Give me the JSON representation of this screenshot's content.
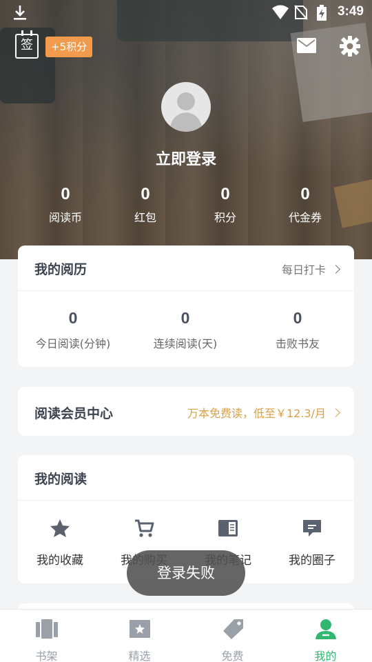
{
  "status_bar": {
    "time": "3:49"
  },
  "header": {
    "sign_icon_char": "签",
    "points_badge": "+5积分",
    "login_text": "立即登录",
    "stats": [
      {
        "value": "0",
        "label": "阅读币"
      },
      {
        "value": "0",
        "label": "红包"
      },
      {
        "value": "0",
        "label": "积分"
      },
      {
        "value": "0",
        "label": "代金券"
      }
    ]
  },
  "history": {
    "title": "我的阅历",
    "link": "每日打卡",
    "items": [
      {
        "value": "0",
        "label": "今日阅读(分钟)"
      },
      {
        "value": "0",
        "label": "连续阅读(天)"
      },
      {
        "value": "0",
        "label": "击败书友"
      }
    ]
  },
  "vip": {
    "title": "阅读会员中心",
    "promo": "万本免费读，低至￥12.3/月"
  },
  "my_reading": {
    "title": "我的阅读",
    "items": [
      {
        "label": "我的收藏",
        "icon": "star-icon"
      },
      {
        "label": "我的购买",
        "icon": "cart-icon"
      },
      {
        "label": "我的笔记",
        "icon": "notebook-icon"
      },
      {
        "label": "我的圈子",
        "icon": "chat-bubble-icon"
      }
    ]
  },
  "toast": {
    "text": "登录失败"
  },
  "bottom_nav": {
    "items": [
      {
        "label": "书架",
        "icon": "bookshelf-icon",
        "active": false
      },
      {
        "label": "精选",
        "icon": "featured-book-icon",
        "active": false
      },
      {
        "label": "免费",
        "icon": "tag-icon",
        "active": false
      },
      {
        "label": "我的",
        "icon": "user-icon",
        "active": true
      }
    ]
  },
  "colors": {
    "accent_green": "#31b76f",
    "badge_orange": "#f29b4c",
    "vip_gold": "#d9a046"
  }
}
